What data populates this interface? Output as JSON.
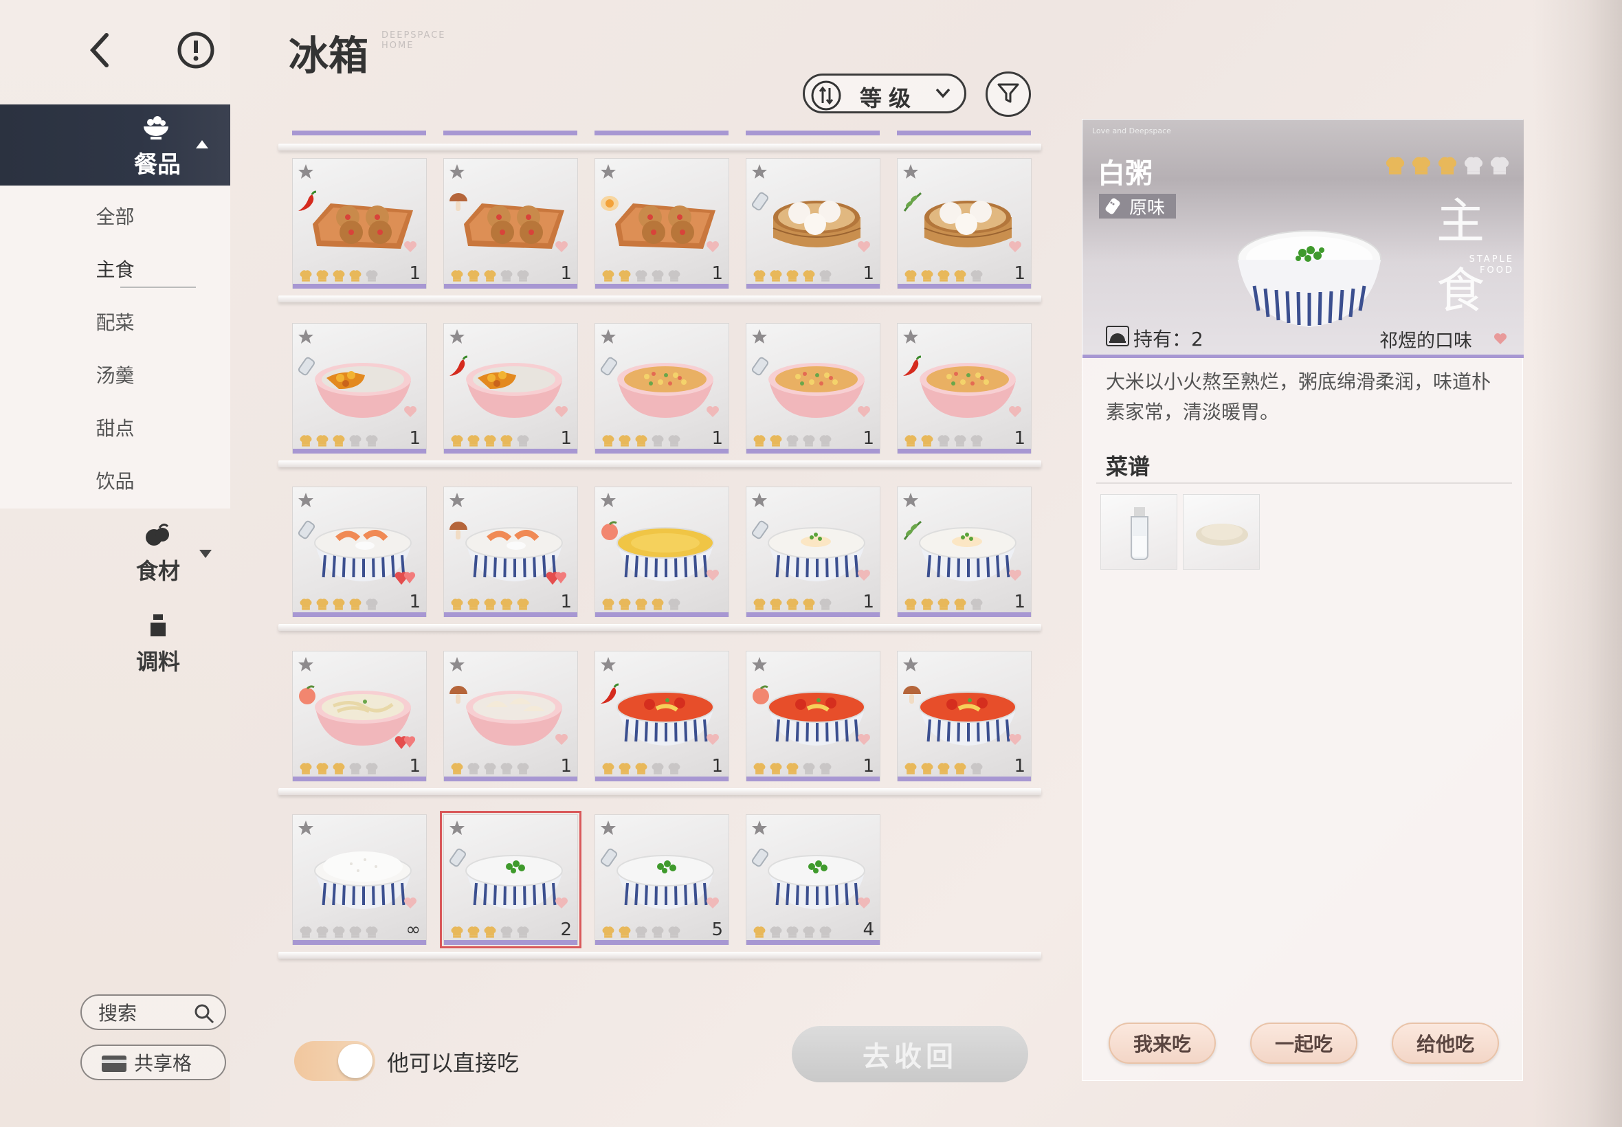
{
  "header": {
    "title": "冰箱",
    "title_sub": "DEEPSPACE HOME"
  },
  "sidebar": {
    "active_category": "餐品",
    "subcategories": [
      "全部",
      "主食",
      "配菜",
      "汤羹",
      "甜点",
      "饮品"
    ],
    "active_subcategory": "主食",
    "other_categories": [
      "食材",
      "调料"
    ],
    "search_label": "搜索",
    "share_label": "共享格"
  },
  "sort": {
    "label": "等级"
  },
  "grid": {
    "rows": [
      [
        {
          "food": "mooncake-tray",
          "tag": "chili",
          "rating": 4,
          "qty": "1",
          "heart": false
        },
        {
          "food": "mooncake-tray",
          "tag": "mushroom",
          "rating": 3,
          "qty": "1",
          "heart": false
        },
        {
          "food": "mooncake-tray",
          "tag": "egg",
          "rating": 2,
          "qty": "1",
          "heart": true
        },
        {
          "food": "bun-steamer",
          "tag": "salt",
          "rating": 4,
          "qty": "1",
          "heart": false
        },
        {
          "food": "bun-steamer",
          "tag": "herb",
          "rating": 4,
          "qty": "1",
          "heart": false
        }
      ],
      [
        {
          "food": "curry-rice",
          "tag": "salt",
          "rating": 3,
          "qty": "1",
          "heart": false
        },
        {
          "food": "curry-rice",
          "tag": "chili",
          "rating": 4,
          "qty": "1",
          "heart": false
        },
        {
          "food": "fried-rice",
          "tag": "salt",
          "rating": 3,
          "qty": "1",
          "heart": false
        },
        {
          "food": "fried-rice",
          "tag": "salt",
          "rating": 2,
          "qty": "1",
          "heart": false
        },
        {
          "food": "fried-rice",
          "tag": "chili",
          "rating": 2,
          "qty": "1",
          "heart": false
        }
      ],
      [
        {
          "food": "shrimp-porridge",
          "tag": "salt",
          "rating": 4,
          "qty": "1",
          "heart": true
        },
        {
          "food": "shrimp-porridge",
          "tag": "mushroom",
          "rating": 5,
          "qty": "1",
          "heart": true
        },
        {
          "food": "egg-porridge",
          "tag": "peach",
          "rating": 4,
          "qty": "",
          "heart": false
        },
        {
          "food": "fish-porridge",
          "tag": "salt",
          "rating": 4,
          "qty": "1",
          "heart": false
        },
        {
          "food": "fish-porridge",
          "tag": "herb",
          "rating": 4,
          "qty": "1",
          "heart": false
        }
      ],
      [
        {
          "food": "noodle-bowl",
          "tag": "peach",
          "rating": 3,
          "qty": "1",
          "heart": true
        },
        {
          "food": "dumpling-bowl",
          "tag": "mushroom",
          "rating": 1,
          "qty": "1",
          "heart": true
        },
        {
          "food": "tomato-noodle",
          "tag": "chili",
          "rating": 3,
          "qty": "1",
          "heart": false
        },
        {
          "food": "tomato-noodle",
          "tag": "peach",
          "rating": 3,
          "qty": "1",
          "heart": false
        },
        {
          "food": "tomato-noodle",
          "tag": "mushroom",
          "rating": 4,
          "qty": "1",
          "heart": false
        }
      ],
      [
        {
          "food": "plain-rice",
          "tag": "",
          "rating": 0,
          "qty": "∞",
          "heart": true
        },
        {
          "food": "white-porridge",
          "tag": "salt",
          "rating": 3,
          "qty": "2",
          "heart": true,
          "selected": true
        },
        {
          "food": "white-porridge",
          "tag": "salt",
          "rating": 2,
          "qty": "5",
          "heart": true
        },
        {
          "food": "white-porridge",
          "tag": "salt",
          "rating": 1,
          "qty": "4",
          "heart": true
        }
      ]
    ]
  },
  "footer": {
    "toggle_label": "他可以直接吃",
    "toggle_on": true,
    "retrieve_label": "去收回"
  },
  "detail": {
    "mini_header": "Love and Deepspace",
    "name": "白粥",
    "rating": 3,
    "max_rating": 5,
    "flavor": "原味",
    "type": "主食",
    "type_en": "STAPLE FOOD",
    "hold_label": "持有：2",
    "taste": "祁煜的口味",
    "description": "大米以小火熬至熟烂，粥底绵滑柔润，味道朴素家常，清淡暖胃。",
    "recipe_title": "菜谱",
    "ingredients": [
      "milk-bottle",
      "rice-grains"
    ],
    "actions": [
      "我来吃",
      "一起吃",
      "给他吃"
    ]
  },
  "colors": {
    "accent_purple": "#a797d2",
    "dark_nav": "#2f3646",
    "star_gold": "#e8b85a",
    "star_gray": "#c9c6c6",
    "selected_red": "#d9585a"
  }
}
